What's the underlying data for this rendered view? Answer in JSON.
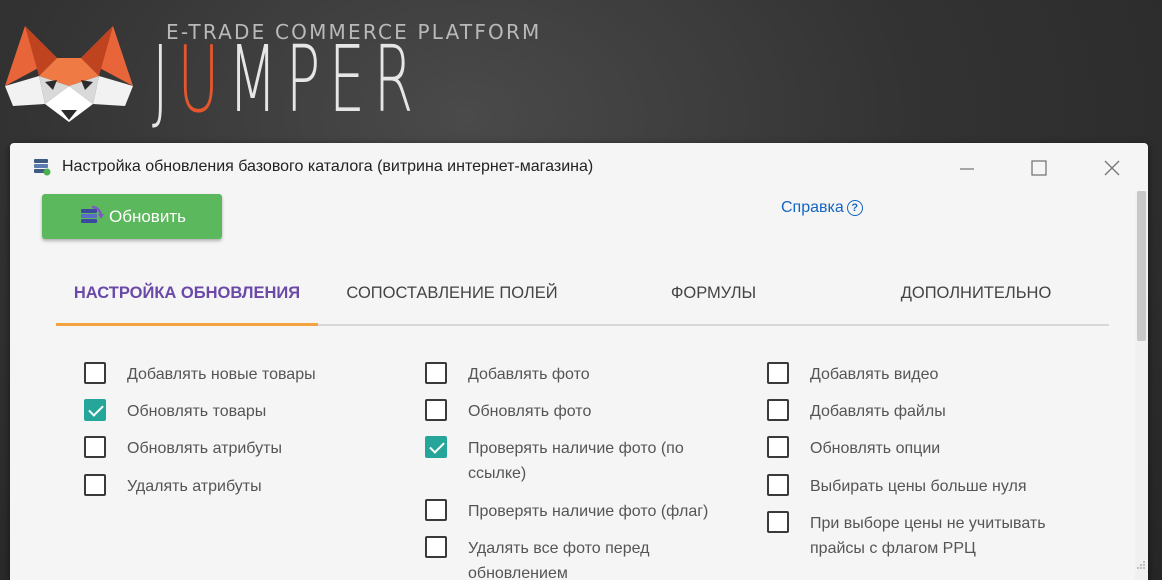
{
  "brand": {
    "tagline": "E-TRADE COMMERCE PLATFORM",
    "name_parts": [
      "J",
      "U",
      "MPER"
    ]
  },
  "window": {
    "title": "Настройка обновления базового каталога (витрина интернет-магазина)",
    "refresh_label": "Обновить",
    "help_label": "Справка"
  },
  "tabs": [
    {
      "label": "НАСТРОЙКА ОБНОВЛЕНИЯ",
      "active": true
    },
    {
      "label": "СОПОСТАВЛЕНИЕ ПОЛЕЙ",
      "active": false
    },
    {
      "label": "ФОРМУЛЫ",
      "active": false
    },
    {
      "label": "ДОПОЛНИТЕЛЬНО",
      "active": false
    }
  ],
  "options": {
    "col1": [
      {
        "label": "Добавлять новые товары",
        "checked": false
      },
      {
        "label": "Обновлять товары",
        "checked": true
      },
      {
        "label": "Обновлять атрибуты",
        "checked": false
      },
      {
        "label": "Удалять атрибуты",
        "checked": false
      }
    ],
    "col2": [
      {
        "label": "Добавлять фото",
        "checked": false
      },
      {
        "label": "Обновлять фото",
        "checked": false
      },
      {
        "label": "Проверять наличие фото (по ссылке)",
        "checked": true
      },
      {
        "label": "Проверять наличие фото (флаг)",
        "checked": false
      },
      {
        "label": "Удалять все фото перед обновлением",
        "checked": false
      }
    ],
    "col3": [
      {
        "label": "Добавлять видео",
        "checked": false
      },
      {
        "label": "Добавлять файлы",
        "checked": false
      },
      {
        "label": "Обновлять опции",
        "checked": false
      },
      {
        "label": "Выбирать цены больше нуля",
        "checked": false
      },
      {
        "label": "При выборе цены не учитывать прайсы с флагом РРЦ",
        "checked": false
      }
    ]
  },
  "colors": {
    "accent_orange": "#e4572e",
    "tab_active": "#6a49a8",
    "tab_underline": "#f5a340",
    "checkbox_checked": "#26a69a",
    "refresh_button": "#5cb85c",
    "link": "#1565c0"
  },
  "icons": {
    "logo": "fox-logo-icon",
    "title": "database-stack-icon",
    "refresh": "refresh-icon",
    "help": "question-circle-icon"
  }
}
